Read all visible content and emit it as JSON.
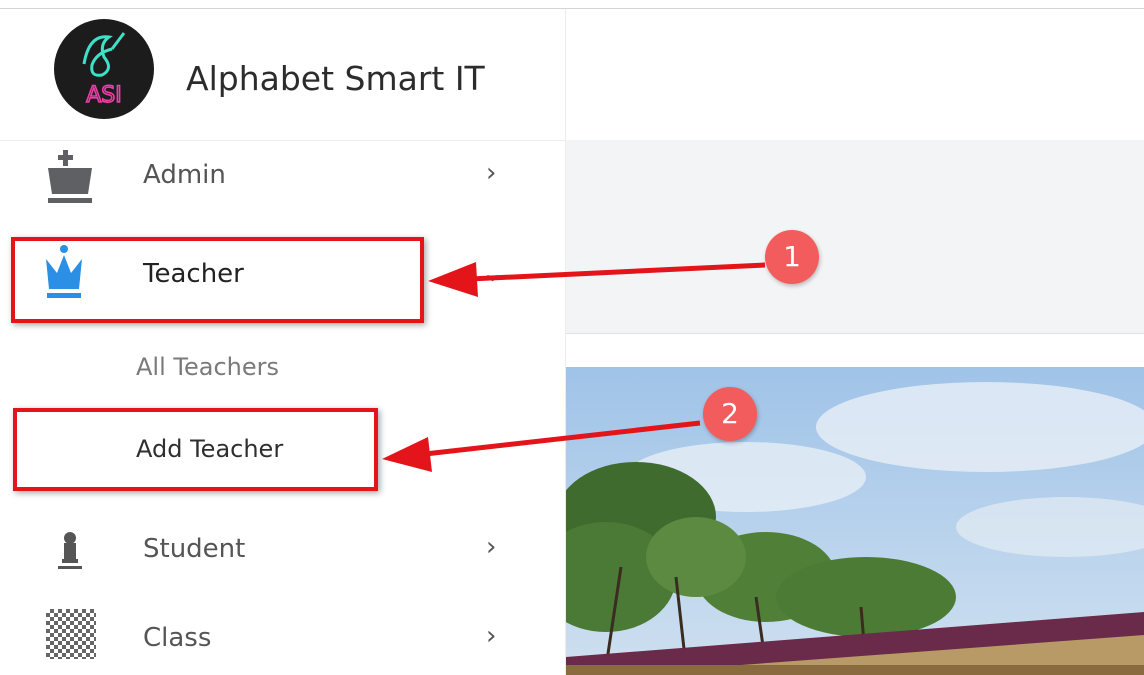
{
  "brand": {
    "name": "Alphabet Smart IT",
    "logo_text": "ASI"
  },
  "menu": {
    "admin": {
      "label": "Admin",
      "icon": "chess-king-icon"
    },
    "teacher": {
      "label": "Teacher",
      "icon": "crown-icon"
    },
    "student": {
      "label": "Student",
      "icon": "chess-pawn-icon"
    },
    "class": {
      "label": "Class",
      "icon": "checkerboard-icon"
    }
  },
  "submenu": {
    "all_teachers": "All Teachers",
    "add_teacher": "Add Teacher"
  },
  "annotations": {
    "step1": "1",
    "step2": "2"
  },
  "colors": {
    "accent_blue": "#2b8fe6",
    "highlight_red": "#e3151a",
    "badge_red": "#f25c5c"
  }
}
